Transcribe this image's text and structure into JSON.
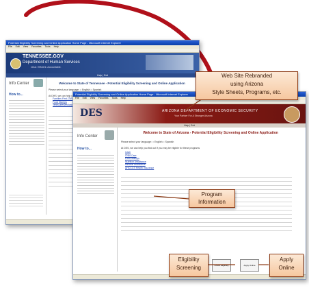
{
  "back_window": {
    "title": "Potential Eligibility Screening and Online Application Home Page - Microsoft Internet Explorer",
    "menu": [
      "File",
      "Edit",
      "View",
      "Favorites",
      "Tools",
      "Help"
    ],
    "brand": "TENNESSEE.GOV",
    "dept": "Department of Human Services",
    "dept_sub": "Clear. Efficient. Accountable.",
    "nav": "Help | Exit",
    "heading": "Welcome to State of Tennessee - Potential Eligibility Screening and Online Application",
    "lang_prompt": "Please select your language:",
    "lang_english": "English",
    "lang_spanish": "Spanish",
    "programs_intro": "At DHS, we can help you find out if you may be eligible for these programs",
    "programs": [
      "Families First (TANF)",
      "Food Stamps",
      "TennCare/Medicaid"
    ],
    "info_center": "Info Center",
    "how_to": "How to..."
  },
  "front_window": {
    "title": "Potential Eligibility Screening and Online Application Home Page - Microsoft Internet Explorer",
    "menu": [
      "File",
      "Edit",
      "View",
      "Favorites",
      "Tools",
      "Help"
    ],
    "logo": "DES",
    "agency": "ARIZONA DEPARTMENT OF ECONOMIC SECURITY",
    "agency_sub": "Your Partner For A Stronger Arizona",
    "nav": "Help | Exit",
    "heading": "Welcome to State of Arizona - Potential Eligibility Screening and Online Application",
    "lang_prompt": "Please select your language:",
    "lang_english": "English",
    "lang_spanish": "Spanish",
    "programs_intro": "At DES, we can help you find out if you may be eligible for these programs",
    "programs": [
      "Cash",
      "Child Care",
      "Food Stamps",
      "Nutrition Assistance",
      "Medical Assistance",
      "AHCCCS Health Insurance"
    ],
    "info_center": "Info Center",
    "how_to": "How to...",
    "btn_eligibility": "Check Eligibility",
    "btn_apply": "Apply Online"
  },
  "callouts": {
    "rebrand_l1": "Web Site Rebranded",
    "rebrand_l2": "using Arizona",
    "rebrand_l3": "Style Sheets, Programs, etc.",
    "program_l1": "Program",
    "program_l2": "Information",
    "eligibility_l1": "Eligibility",
    "eligibility_l2": "Screening",
    "apply_l1": "Apply",
    "apply_l2": "Online"
  },
  "colors": {
    "arrow": "#b0101a",
    "callout_border": "#8c3a14",
    "tn_header": "#1c3a78",
    "az_header": "#8a1a14"
  }
}
